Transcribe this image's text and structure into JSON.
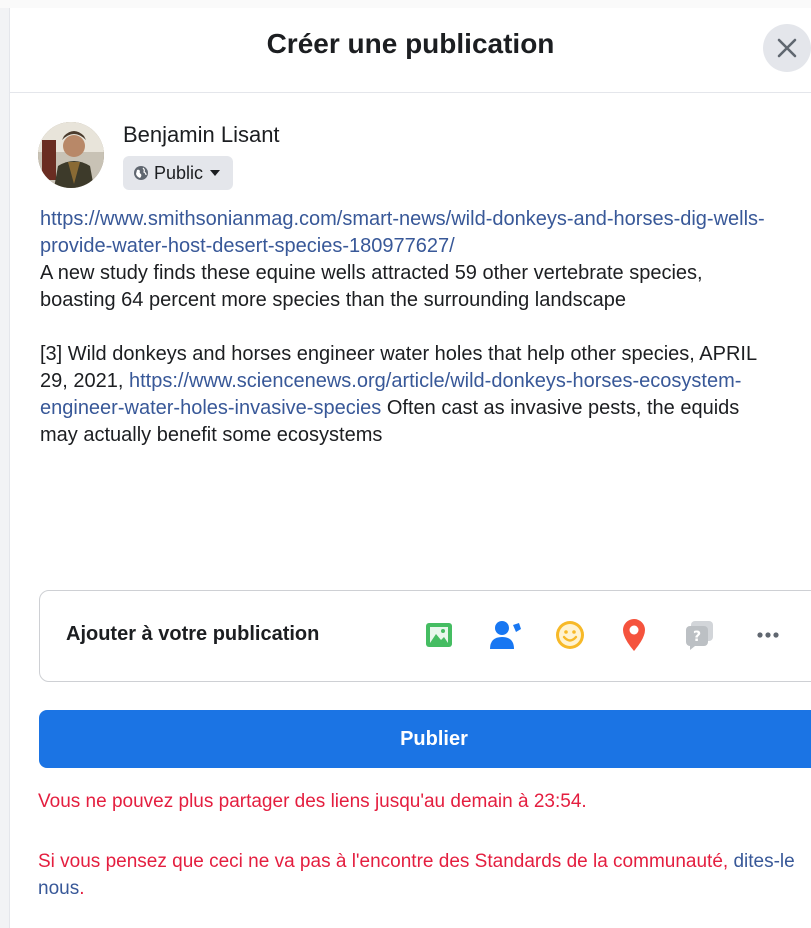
{
  "dialog": {
    "title": "Créer une publication",
    "close_icon": "close-icon"
  },
  "author": {
    "name": "Benjamin Lisant",
    "audience": "Public",
    "audience_icon": "globe-icon",
    "caret_icon": "caret-down-icon"
  },
  "post": {
    "link1": "https://www.smithsonianmag.com/smart-news/wild-donkeys-and-horses-dig-wells-provide-water-host-desert-species-180977627/",
    "summary1": "A new study finds these equine wells attracted 59 other vertebrate species, boasting 64 percent more species than the surrounding landscape",
    "ref3_text": "[3] Wild donkeys and horses engineer water holes that help other species, APRIL 29, 2021,",
    "link2": "https://www.sciencenews.org/article/wild-donkeys-horses-ecosystem-engineer-water-holes-invasive-species",
    "summary2": "Often cast as invasive pests, the equids may actually benefit some ecosystems"
  },
  "add_to_post": {
    "label": "Ajouter à votre publication",
    "icons": [
      "photo-video-icon",
      "tag-people-icon",
      "feeling-icon",
      "check-in-icon",
      "gif-icon",
      "more-icon"
    ]
  },
  "publish_button": "Publier",
  "errors": {
    "limit": "Vous ne pouvez plus partager des liens jusqu'au demain à 23:54.",
    "appeal_prefix": "Si vous pensez que ceci ne va pas à l'encontre des Standards de la communauté,",
    "appeal_link": "dites-le nous",
    "appeal_suffix": "."
  },
  "colors": {
    "primary": "#1b74e4",
    "link": "#385898",
    "error": "#e41e3f",
    "photo": "#45bd62",
    "tag": "#1877f2",
    "feeling": "#f7b928",
    "checkin": "#f5533d",
    "gif": "#bcc0c4"
  }
}
